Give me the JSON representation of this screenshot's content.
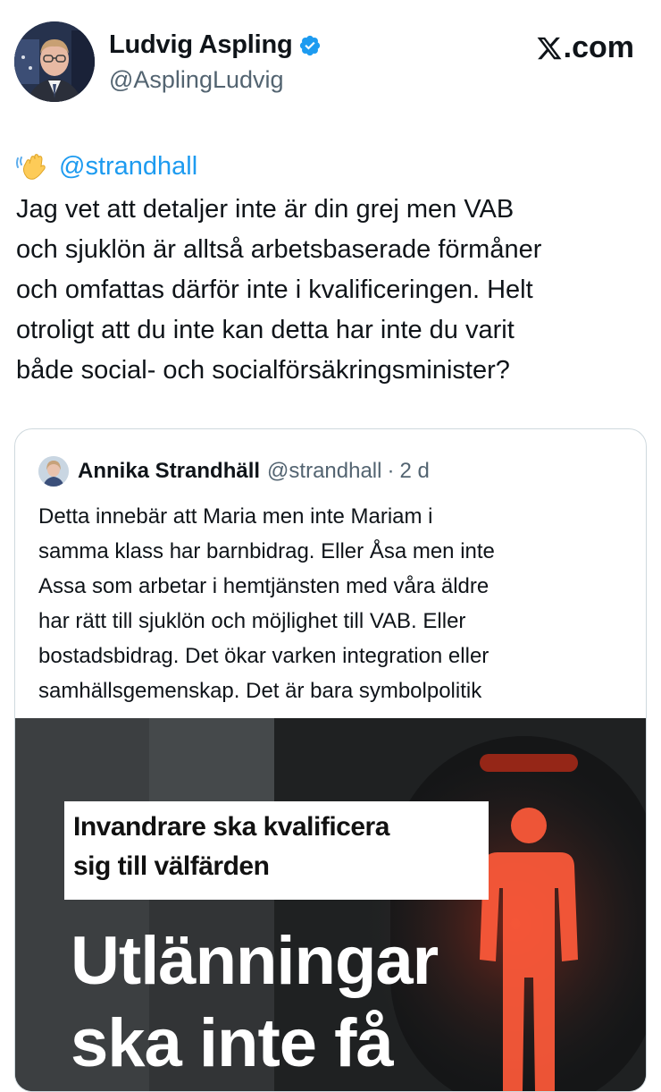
{
  "author": {
    "display_name": "Ludvig Aspling",
    "handle": "@AsplingLudvig",
    "verified": true
  },
  "branding": {
    "site": ".com",
    "logo_icon": "x-logo-icon"
  },
  "tweet": {
    "emoji_icon": "waving-hand-icon",
    "mention": "@strandhall",
    "lines": [
      "Jag vet att detaljer inte är din grej men VAB",
      "och sjuklön är alltså arbetsbaserade förmåner",
      "och omfattas därför inte i kvalificeringen. Helt",
      "otroligt att du inte kan detta har inte du varit",
      "både social- och socialförsäkringsminister?"
    ]
  },
  "quoted": {
    "display_name": "Annika Strandhäll",
    "handle": "@strandhall",
    "separator": "·",
    "time": "2 d",
    "lines": [
      "Detta innebär att Maria men inte Mariam i",
      "samma klass har barnbidrag. Eller Åsa men inte",
      "Assa som arbetar i hemtjänsten med våra äldre",
      "har rätt till sjuklön och möjlighet till VAB. Eller",
      "bostadsbidrag. Det ökar varken integration eller",
      "samhällsgemenskap. Det är bara symbolpolitik"
    ],
    "media": {
      "caption_line1": "Invandrare ska kvalificera",
      "caption_line2": "sig till välfärden",
      "headline_line1": "Utlänningar",
      "headline_line2": "ska inte få"
    }
  },
  "colors": {
    "link": "#1d9bf0",
    "verified": "#1d9bf0",
    "secondary_text": "#536471",
    "traffic_light_red": "#ff4a2e"
  }
}
